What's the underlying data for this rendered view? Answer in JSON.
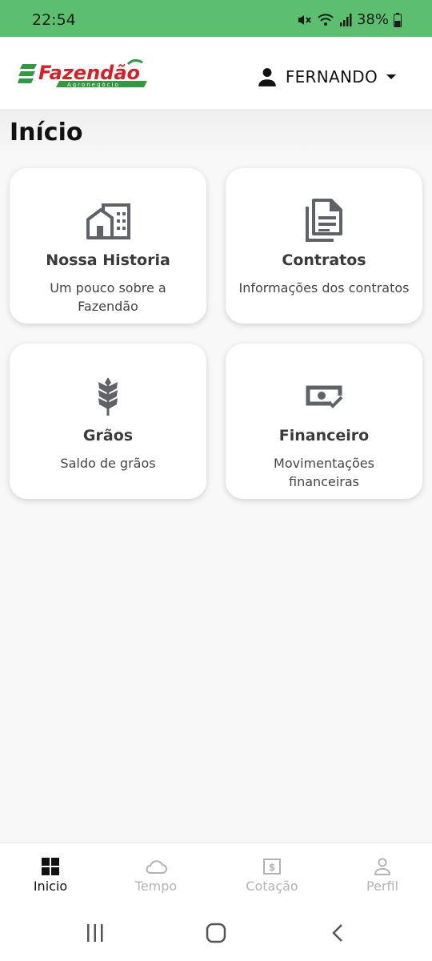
{
  "status_bar": {
    "time": "22:54",
    "battery": "38%",
    "icons": [
      "mute-icon",
      "wifi-icon",
      "signal-icon",
      "battery-icon"
    ]
  },
  "header": {
    "logo": {
      "brand": "Fazendão",
      "tagline": "Agronegócio"
    },
    "user_name": "FERNANDO",
    "user_icon": "person-icon",
    "dropdown_icon": "caret-down-icon"
  },
  "page": {
    "title": "Início"
  },
  "cards": [
    {
      "title": "Nossa Historia",
      "subtitle": "Um pouco sobre a Fazendão",
      "icon": "buildings-icon"
    },
    {
      "title": "Contratos",
      "subtitle": "Informações dos contratos",
      "icon": "document-copy-icon"
    },
    {
      "title": "Grãos",
      "subtitle": "Saldo de grãos",
      "icon": "grain-icon"
    },
    {
      "title": "Financeiro",
      "subtitle": "Movimentações financeiras",
      "icon": "money-check-icon"
    }
  ],
  "bottom_nav": {
    "active": "Inicio",
    "items": [
      {
        "label": "Inicio",
        "icon": "grid-icon"
      },
      {
        "label": "Tempo",
        "icon": "cloud-icon"
      },
      {
        "label": "Cotação",
        "icon": "dollar-box-icon"
      },
      {
        "label": "Perfil",
        "icon": "person-outline-icon"
      }
    ]
  },
  "colors": {
    "status_bar_bg": "#5cbf6f",
    "logo_red": "#d81f26",
    "logo_green": "#2f9a3f",
    "icon_gray": "#5f6368",
    "nav_active": "#111111",
    "nav_inactive": "#b3b3b3"
  }
}
